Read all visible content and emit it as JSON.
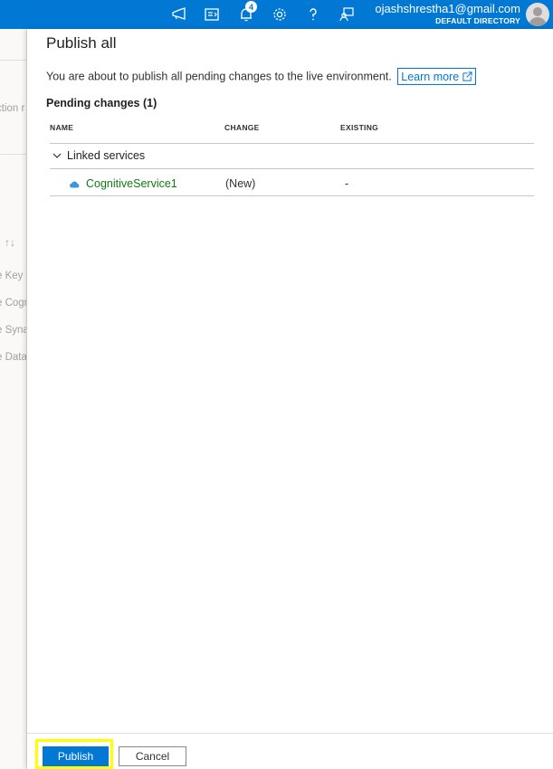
{
  "topbar": {
    "icons": [
      "feedback-megaphone-icon",
      "directory-switch-icon",
      "notifications-bell-icon",
      "settings-gear-icon",
      "help-icon",
      "feedback-icon"
    ],
    "notification_count": "4",
    "user_email": "ojashshrestha1@gmail.com",
    "user_directory": "DEFAULT DIRECTORY",
    "accent": "#0078d4"
  },
  "background_page": {
    "partial_texts": [
      "ction r",
      "e Key",
      "e Cogn",
      "e Syna",
      "e Data"
    ],
    "sort_icon": "sort-icon"
  },
  "panel": {
    "title": "Publish all",
    "description": "You are about to publish all pending changes to the live environment.",
    "learn_more": "Learn more",
    "pending_label": "Pending changes (1)",
    "columns": [
      "NAME",
      "CHANGE",
      "EXISTING"
    ],
    "group": {
      "label": "Linked services",
      "items": [
        {
          "name": "CognitiveService1",
          "change": "(New)",
          "existing": "-"
        }
      ]
    }
  },
  "footer": {
    "publish_label": "Publish",
    "cancel_label": "Cancel"
  }
}
